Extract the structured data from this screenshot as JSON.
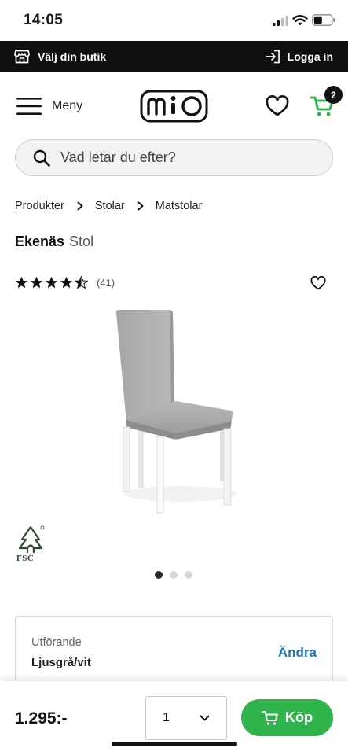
{
  "status_bar": {
    "time": "14:05"
  },
  "top_strip": {
    "store_label": "Välj din butik",
    "login_label": "Logga in"
  },
  "header": {
    "menu_label": "Meny",
    "logo_text": "MIO",
    "cart_count": "2"
  },
  "search": {
    "placeholder": "Vad letar du efter?"
  },
  "breadcrumb": [
    "Produkter",
    "Stolar",
    "Matstolar"
  ],
  "product": {
    "brand": "Ekenäs",
    "type": "Stol",
    "rating": 4.5,
    "review_count": "(41)",
    "certification": "FSC",
    "image_count": 3,
    "active_image": 1
  },
  "variant": {
    "label": "Utförande",
    "value": "Ljusgrå/vit",
    "change_label": "Ändra"
  },
  "purchase": {
    "price": "1.295:-",
    "quantity": "1",
    "buy_label": "Köp"
  },
  "colors": {
    "accent_green": "#2fb34a",
    "link_blue": "#1a74b8",
    "strip_black": "#0f0f0f"
  }
}
